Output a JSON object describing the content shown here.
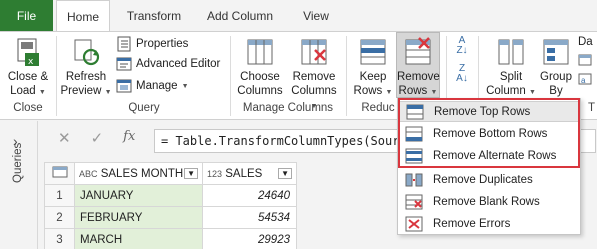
{
  "tabs": {
    "file": "File",
    "home": "Home",
    "transform": "Transform",
    "add_column": "Add Column",
    "view": "View"
  },
  "ribbon": {
    "close_load": "Close &",
    "close_load2": "Load",
    "refresh_preview": "Refresh",
    "refresh_preview2": "Preview",
    "properties": "Properties",
    "advanced_editor": "Advanced Editor",
    "manage": "Manage",
    "choose_columns": "Choose",
    "choose_columns2": "Columns",
    "remove_columns": "Remove",
    "remove_columns2": "Columns",
    "keep_rows": "Keep",
    "keep_rows2": "Rows",
    "remove_rows": "Remove",
    "remove_rows2": "Rows",
    "split_column": "Split",
    "split_column2": "Column",
    "group_by": "Group",
    "group_by2": "By",
    "cut_da": "Da",
    "group_close": "Close",
    "group_query": "Query",
    "group_manage_columns": "Manage Columns",
    "group_reduce": "Reduc",
    "group_t": "T"
  },
  "side_pane": {
    "label": "Queries"
  },
  "formula_bar": {
    "formula": "= Table.TransformColumnTypes(Source"
  },
  "grid": {
    "columns": [
      {
        "type_label": "ABC",
        "name": "SALES MONTH"
      },
      {
        "type_label": "123",
        "name": "SALES"
      }
    ],
    "rows": [
      {
        "num": "1",
        "month": "JANUARY",
        "sales": "24640"
      },
      {
        "num": "2",
        "month": "FEBRUARY",
        "sales": "54534"
      },
      {
        "num": "3",
        "month": "MARCH",
        "sales": "29923"
      }
    ]
  },
  "dropdown": {
    "items": [
      "Remove Top Rows",
      "Remove Bottom Rows",
      "Remove Alternate Rows",
      "Remove Duplicates",
      "Remove Blank Rows",
      "Remove Errors"
    ]
  },
  "colors": {
    "file_tab": "#2e7d32",
    "highlight": "#d9363e",
    "month_column": "#e2f0d9"
  }
}
